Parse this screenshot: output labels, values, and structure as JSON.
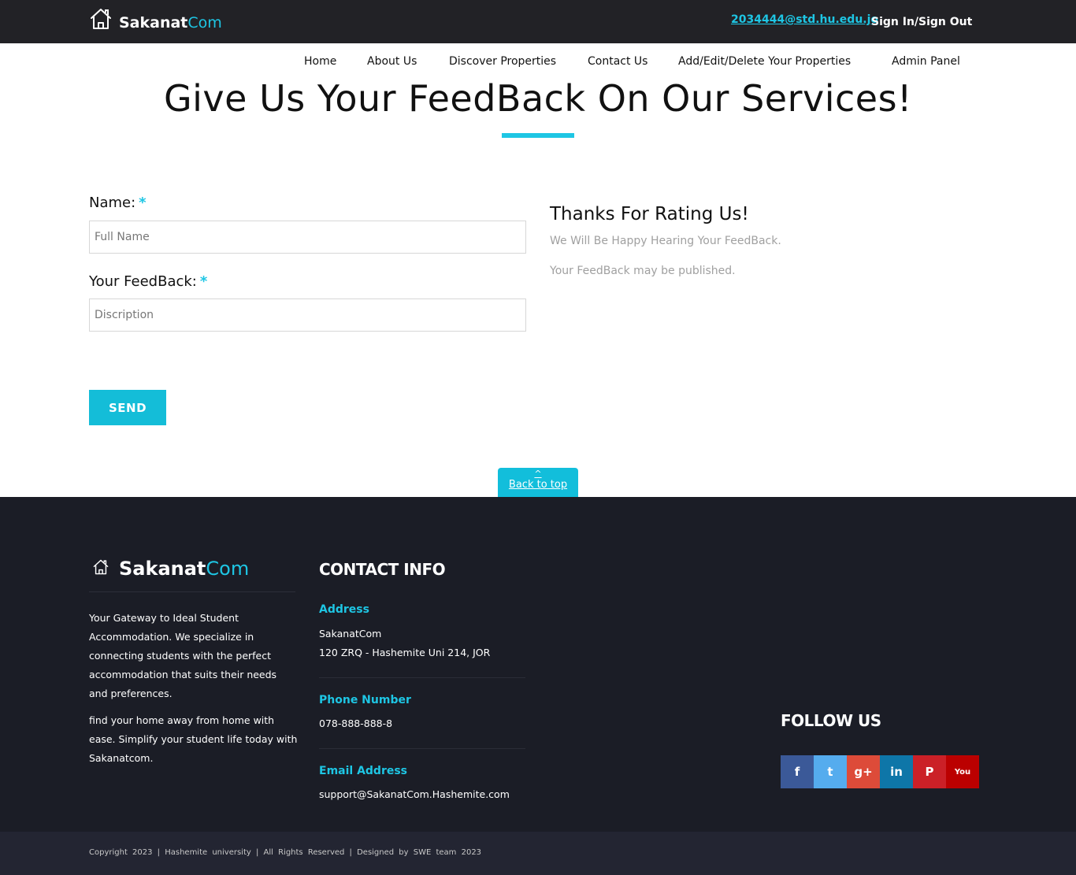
{
  "header": {
    "logo": {
      "part1": "Sakanat",
      "part2": "Com"
    },
    "user_email": "2034444@std.hu.edu.jo",
    "sign_label": "Sign In/Sign Out"
  },
  "nav": {
    "items": [
      "Home",
      "About Us",
      "Discover Properties",
      "Contact Us",
      "Add/Edit/Delete Your Properties",
      "Admin Panel"
    ]
  },
  "page": {
    "title": "Give Us Your FeedBack On Our Services!"
  },
  "form": {
    "name_label": "Name:",
    "name_required": "*",
    "name_placeholder": "Full Name",
    "feedback_label": "Your FeedBack:",
    "feedback_required": "*",
    "feedback_placeholder": "Discription",
    "send_label": "SEND"
  },
  "thanks": {
    "title": "Thanks For Rating Us!",
    "line1": "We Will Be Happy Hearing Your FeedBack.",
    "line2": "Your FeedBack may be published."
  },
  "back_to_top": {
    "chevron": "^",
    "label": "Back to top"
  },
  "footer": {
    "logo": {
      "part1": "Sakanat",
      "part2": "Com"
    },
    "about_p1": "Your Gateway to Ideal Student Accommodation. We specialize in connecting students with the perfect accommodation that suits their needs and preferences.",
    "about_p2": "find your home away from home with ease. Simplify your student life today with Sakanatcom.",
    "contact_heading": "CONTACT INFO",
    "address_label": "Address",
    "address_line1": "SakanatCom",
    "address_line2": "120 ZRQ - Hashemite Uni 214, JOR",
    "phone_label": "Phone Number",
    "phone": "078-888-888-8",
    "email_label": "Email Address",
    "email": "support@SakanatCom.Hashemite.com",
    "follow_heading": "FOLLOW US",
    "social": [
      {
        "name": "facebook",
        "glyph": "f",
        "color": "#3b5998"
      },
      {
        "name": "twitter",
        "glyph": "t",
        "color": "#55acee"
      },
      {
        "name": "google-plus",
        "glyph": "g+",
        "color": "#dd4b39"
      },
      {
        "name": "linkedin",
        "glyph": "in",
        "color": "#0e76a8"
      },
      {
        "name": "pinterest",
        "glyph": "P",
        "color": "#cb2027"
      },
      {
        "name": "youtube",
        "glyph": "You",
        "color": "#bb0000"
      }
    ]
  },
  "bottom": {
    "copyright": "Copyright 2023 | Hashemite university | All Rights Reserved | Designed by SWE team 2023"
  },
  "colors": {
    "accent": "#1ec6e4",
    "topbar": "#222226",
    "footer": "#1b1d26",
    "bottombar": "#232532"
  }
}
